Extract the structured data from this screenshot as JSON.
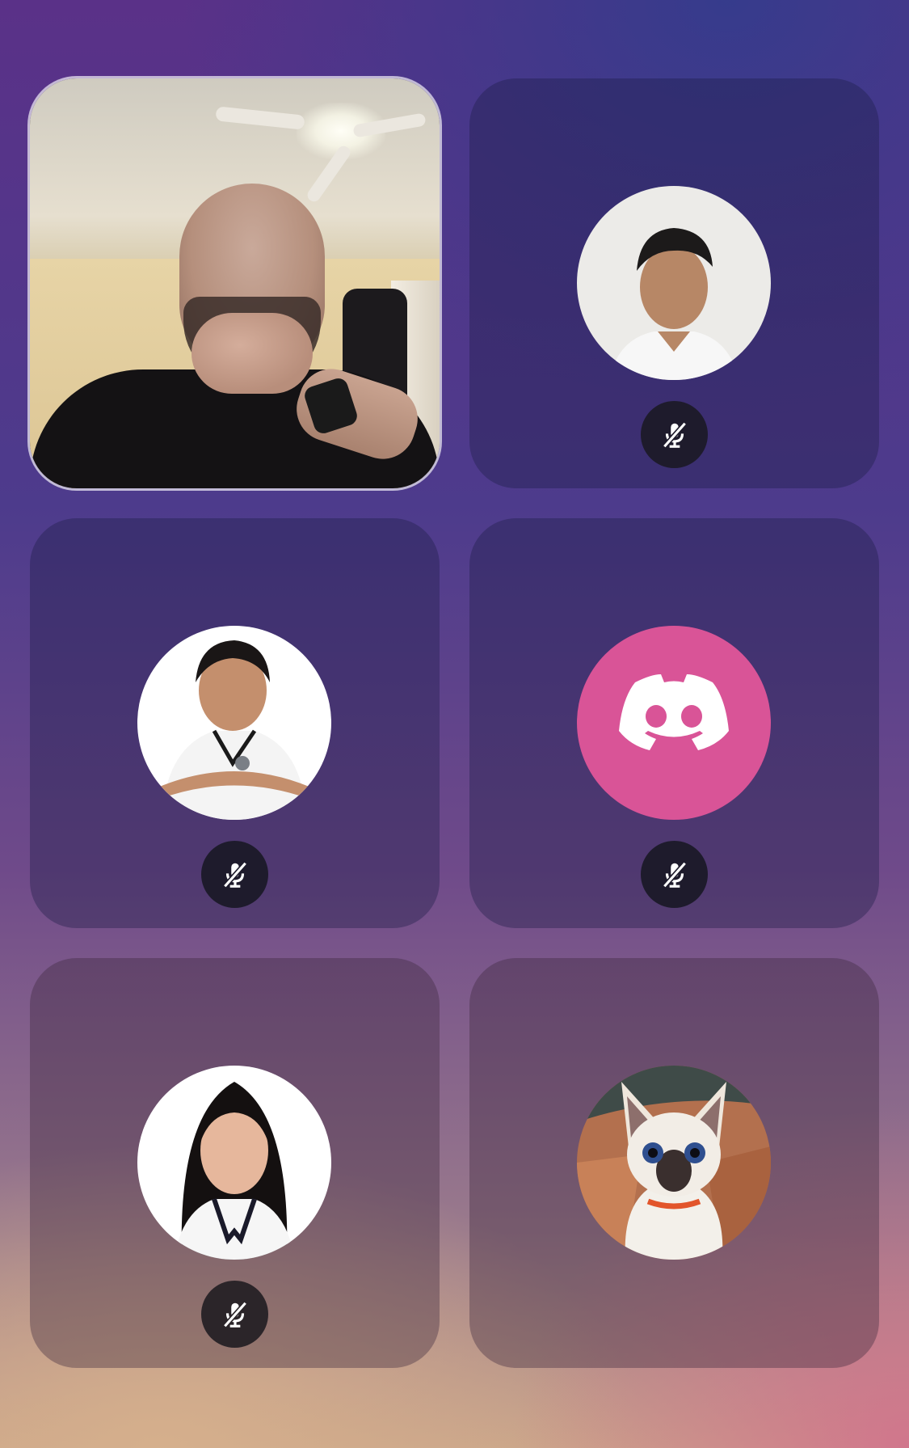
{
  "call": {
    "participants": [
      {
        "id": "p1",
        "kind": "video",
        "muted": false,
        "icon": "camera-feed"
      },
      {
        "id": "p2",
        "kind": "avatar",
        "muted": true,
        "icon": "microphone-muted-icon"
      },
      {
        "id": "p3",
        "kind": "avatar",
        "muted": true,
        "icon": "microphone-muted-icon"
      },
      {
        "id": "p4",
        "kind": "avatar",
        "avatar_icon": "discord-logo-icon",
        "avatar_color": "#d95497",
        "muted": true,
        "icon": "microphone-muted-icon"
      },
      {
        "id": "p5",
        "kind": "avatar",
        "muted": true,
        "icon": "microphone-muted-icon"
      },
      {
        "id": "p6",
        "kind": "avatar",
        "muted": false
      }
    ]
  },
  "colors": {
    "discord_pink": "#d95497",
    "mute_badge": "#1e1b2c",
    "tile_overlay": "rgba(30,30,70,0.38)"
  }
}
